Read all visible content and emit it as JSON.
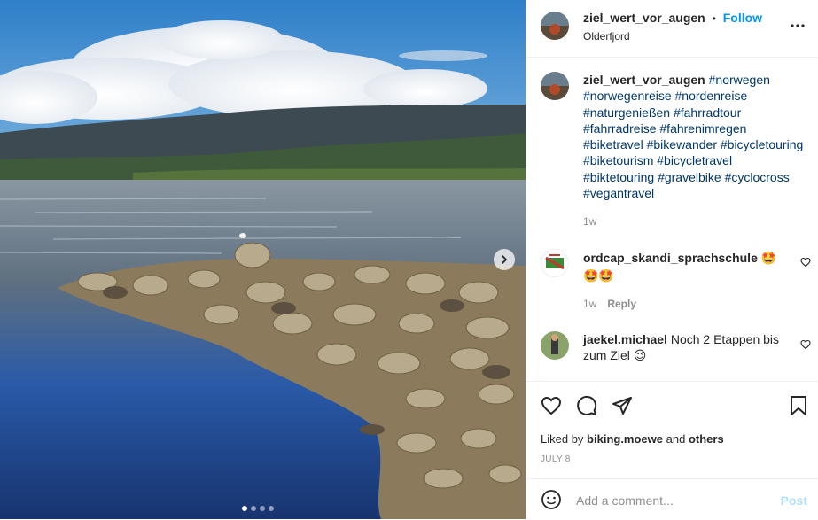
{
  "post": {
    "username": "ziel_wert_vor_augen",
    "follow_label": "Follow",
    "separator": "•",
    "location": "Olderfjord"
  },
  "caption": {
    "username": "ziel_wert_vor_augen",
    "hashtags": [
      "#norwegen",
      "#norwegenreise",
      "#nordenreise",
      "#naturgenießen",
      "#fahrradtour",
      "#fahrradreise",
      "#fahrenimregen",
      "#biketravel",
      "#bikewander",
      "#bicycletouring",
      "#biketourism",
      "#bicycletravel",
      "#biktetouring",
      "#gravelbike",
      "#cyclocross",
      "#vegantravel"
    ],
    "age": "1w"
  },
  "comments": [
    {
      "username": "ordcap_skandi_sprachschule",
      "text": "🤩🤩🤩",
      "age": "1w",
      "reply_label": "Reply"
    },
    {
      "username": "jaekel.michael",
      "text": "Noch 2 Etappen bis zum Ziel 😉"
    }
  ],
  "likes": {
    "prefix": "Liked by ",
    "user": "biking.moewe",
    "middle": " and ",
    "others": "others"
  },
  "date": "JULY 8",
  "add_comment": {
    "placeholder": "Add a comment...",
    "post_label": "Post"
  },
  "carousel": {
    "slide_count": 4,
    "active_index": 0
  },
  "icons": [
    "heart-icon",
    "comment-icon",
    "share-icon",
    "bookmark-icon",
    "emoji-icon",
    "more-icon",
    "chevron-right-icon"
  ],
  "colors": {
    "link": "#0095f6",
    "hashtag": "#00376b",
    "muted": "#8e8e8e"
  }
}
